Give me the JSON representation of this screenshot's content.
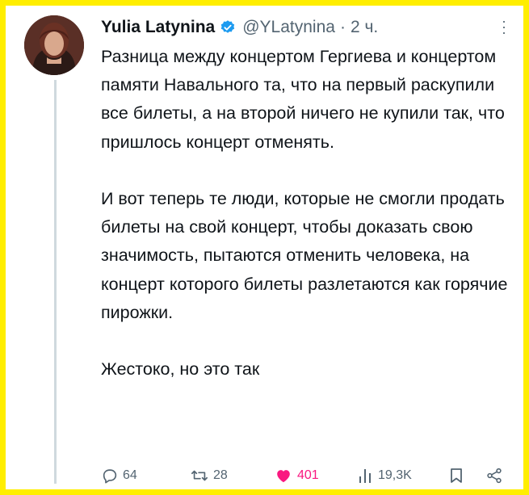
{
  "tweet": {
    "author_name": "Yulia Latynina",
    "handle": "@YLatynina",
    "separator": "·",
    "time": "2 ч.",
    "paragraphs": [
      "Разница между концертом Гергиева и концертом памяти Навального та, что на первый раскупили все билеты, а на второй ничего не купили так, что пришлось концерт отменять.",
      "И вот теперь те люди, которые не смогли продать билеты на свой концерт, чтобы доказать свою значимость, пытаются отменить человека, на концерт которого билеты разлетаются как горячие пирожки.",
      "Жестоко, но это так"
    ]
  },
  "actions": {
    "replies": "64",
    "retweets": "28",
    "likes": "401",
    "views": "19,3K"
  },
  "colors": {
    "frame": "#ffee00",
    "verified": "#1d9bf0",
    "like": "#f91880",
    "muted": "#536471",
    "text": "#0f1419"
  },
  "icons": [
    "avatar",
    "verified-badge-icon",
    "more-options-icon",
    "reply-icon",
    "retweet-icon",
    "like-icon",
    "views-icon",
    "bookmark-icon",
    "share-icon"
  ]
}
